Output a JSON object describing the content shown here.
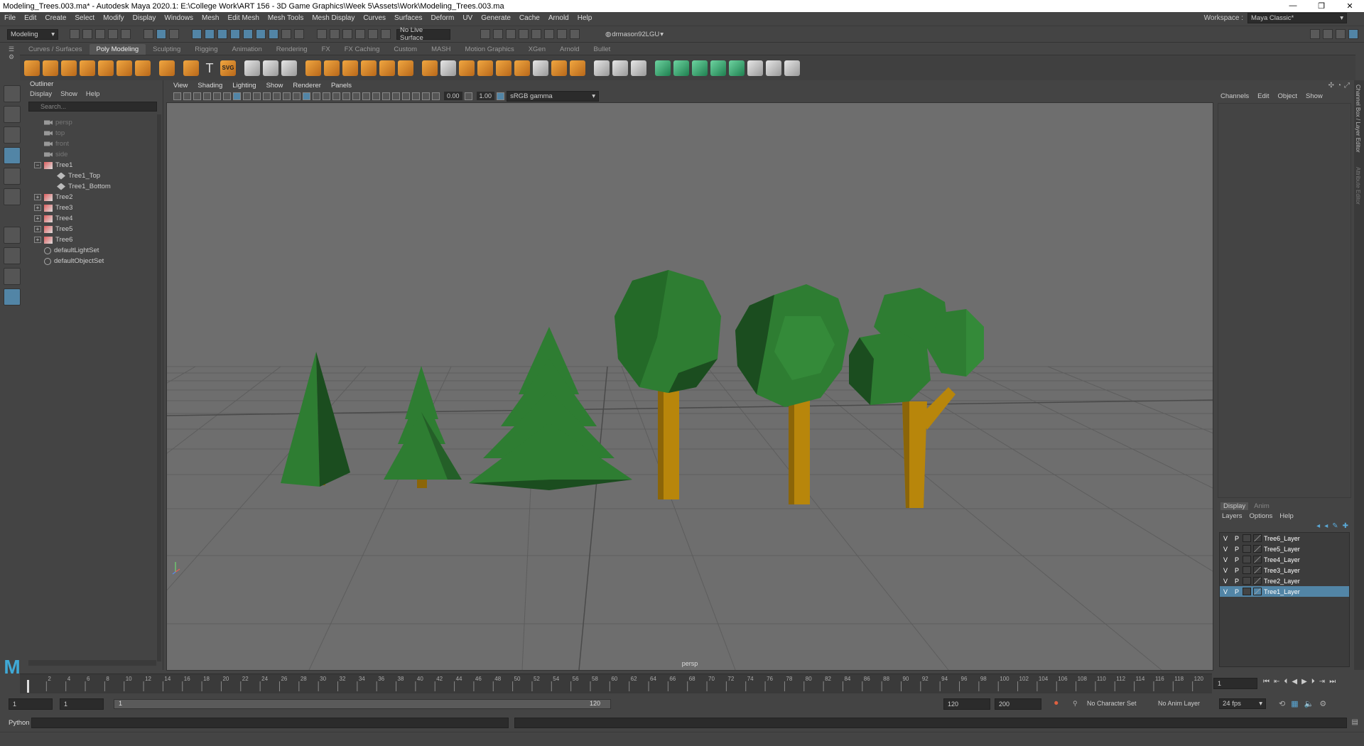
{
  "window": {
    "title": "Modeling_Trees.003.ma* - Autodesk Maya 2020.1: E:\\College Work\\ART 156 - 3D Game Graphics\\Week 5\\Assets\\Work\\Modeling_Trees.003.ma",
    "controls": [
      "—",
      "❐",
      "✕"
    ]
  },
  "menubar": {
    "items": [
      "File",
      "Edit",
      "Create",
      "Select",
      "Modify",
      "Display",
      "Windows",
      "Mesh",
      "Edit Mesh",
      "Mesh Tools",
      "Mesh Display",
      "Curves",
      "Surfaces",
      "Deform",
      "UV",
      "Generate",
      "Cache",
      "Arnold",
      "Help"
    ],
    "workspace_label": "Workspace :",
    "workspace_value": "Maya Classic*"
  },
  "statusline": {
    "menuset": "Modeling",
    "live_surface": "No Live Surface",
    "user": "drmason92LGU"
  },
  "shelf": {
    "tabs": [
      "Curves / Surfaces",
      "Poly Modeling",
      "Sculpting",
      "Rigging",
      "Animation",
      "Rendering",
      "FX",
      "FX Caching",
      "Custom",
      "MASH",
      "Motion Graphics",
      "XGen",
      "Arnold",
      "Bullet"
    ],
    "active_tab": "Poly Modeling",
    "svg_label": "SVG"
  },
  "outliner": {
    "title": "Outliner",
    "menu": [
      "Display",
      "Show",
      "Help"
    ],
    "search_placeholder": "Search...",
    "items": [
      {
        "label": "persp",
        "kind": "camera",
        "dim": true,
        "depth": 0
      },
      {
        "label": "top",
        "kind": "camera",
        "dim": true,
        "depth": 0
      },
      {
        "label": "front",
        "kind": "camera",
        "dim": true,
        "depth": 0
      },
      {
        "label": "side",
        "kind": "camera",
        "dim": true,
        "depth": 0
      },
      {
        "label": "Tree1",
        "kind": "group",
        "expanded": true,
        "depth": 0
      },
      {
        "label": "Tree1_Top",
        "kind": "mesh",
        "depth": 1
      },
      {
        "label": "Tree1_Bottom",
        "kind": "mesh",
        "depth": 1
      },
      {
        "label": "Tree2",
        "kind": "group",
        "depth": 0
      },
      {
        "label": "Tree3",
        "kind": "group",
        "depth": 0
      },
      {
        "label": "Tree4",
        "kind": "group",
        "depth": 0
      },
      {
        "label": "Tree5",
        "kind": "group",
        "depth": 0
      },
      {
        "label": "Tree6",
        "kind": "group",
        "depth": 0
      },
      {
        "label": "defaultLightSet",
        "kind": "set",
        "depth": 0
      },
      {
        "label": "defaultObjectSet",
        "kind": "set",
        "depth": 0
      }
    ]
  },
  "viewport": {
    "menu": [
      "View",
      "Shading",
      "Lighting",
      "Show",
      "Renderer",
      "Panels"
    ],
    "exposure": "0.00",
    "gamma": "1.00",
    "color_space": "sRGB gamma",
    "camera_label": "persp",
    "colors": {
      "background": "#6e6e6e",
      "foliage": "#2e7d32",
      "trunk": "#b8860b"
    }
  },
  "channelbox": {
    "menu": [
      "Channels",
      "Edit",
      "Object",
      "Show"
    ]
  },
  "layers": {
    "tabs": [
      "Display",
      "Anim"
    ],
    "menu": [
      "Layers",
      "Options",
      "Help"
    ],
    "rows": [
      {
        "v": "V",
        "p": "P",
        "name": "Tree6_Layer",
        "selected": false
      },
      {
        "v": "V",
        "p": "P",
        "name": "Tree5_Layer",
        "selected": false
      },
      {
        "v": "V",
        "p": "P",
        "name": "Tree4_Layer",
        "selected": false
      },
      {
        "v": "V",
        "p": "P",
        "name": "Tree3_Layer",
        "selected": false
      },
      {
        "v": "V",
        "p": "P",
        "name": "Tree2_Layer",
        "selected": false
      },
      {
        "v": "V",
        "p": "P",
        "name": "Tree1_Layer",
        "selected": true
      }
    ]
  },
  "sidetabs": [
    "Channel Box / Layer Editor",
    "Attribute Editor"
  ],
  "timeline": {
    "ticks": [
      "2",
      "4",
      "6",
      "8",
      "10",
      "12",
      "14",
      "16",
      "18",
      "20",
      "22",
      "24",
      "26",
      "28",
      "30",
      "32",
      "34",
      "36",
      "38",
      "40",
      "42",
      "44",
      "46",
      "48",
      "50",
      "52",
      "54",
      "56",
      "58",
      "60",
      "62",
      "64",
      "66",
      "68",
      "70",
      "72",
      "74",
      "76",
      "78",
      "80",
      "82",
      "84",
      "86",
      "88",
      "90",
      "92",
      "94",
      "96",
      "98",
      "100",
      "102",
      "104",
      "106",
      "108",
      "110",
      "112",
      "114",
      "116",
      "118",
      "120"
    ],
    "current_frame": "1"
  },
  "range": {
    "start": "1",
    "playback_start": "1",
    "slider_start": "1",
    "slider_end": "120",
    "playback_end": "120",
    "end": "200",
    "character_set": "No Character Set",
    "anim_layer": "No Anim Layer",
    "fps": "24 fps"
  },
  "cmdline": {
    "language": "Python"
  }
}
